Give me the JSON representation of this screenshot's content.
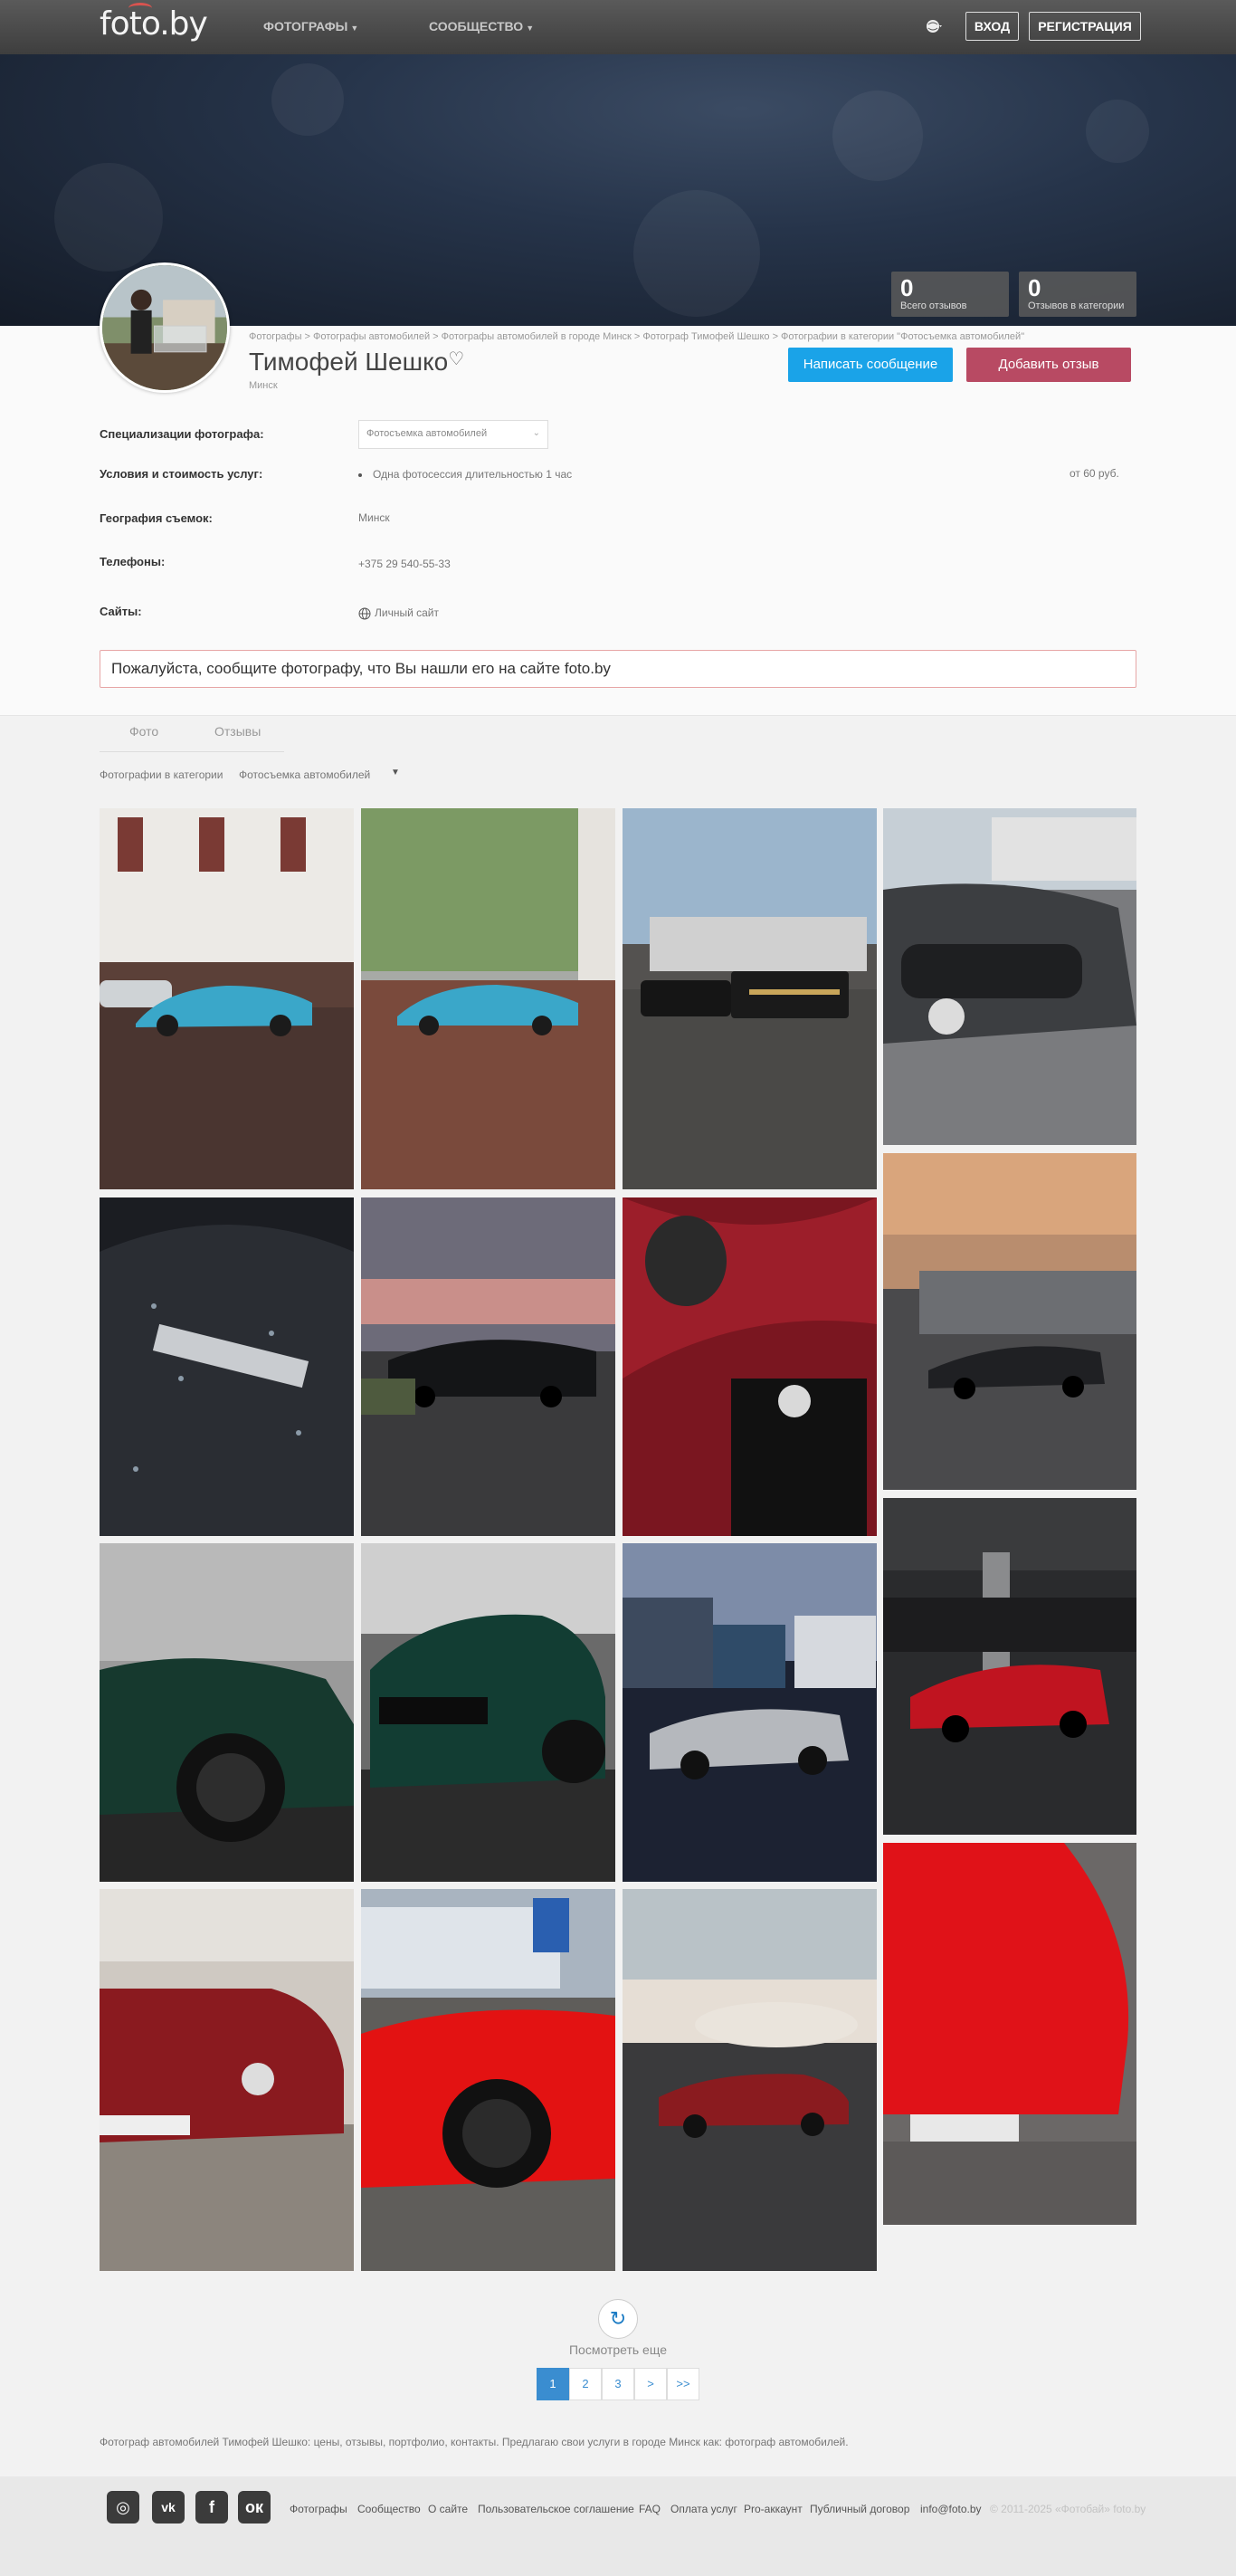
{
  "nav": {
    "logo": "foto.by",
    "photographers": "ФОТОГРАФЫ",
    "community": "СООБЩЕСТВО",
    "login": "ВХОД",
    "register": "РЕГИСТРАЦИЯ"
  },
  "stats": [
    {
      "num": "0",
      "label": "Всего отзывов"
    },
    {
      "num": "0",
      "label": "Отзывов в категории"
    }
  ],
  "breadcrumbs": "Фотографы > Фотографы автомобилей > Фотографы автомобилей в городе Минск > Фотограф Тимофей Шешко > Фотографии в категории \"Фотосъемка автомобилей\"",
  "profile": {
    "name": "Тимофей Шешко",
    "city": "Минск",
    "write_message": "Написать сообщение",
    "add_review": "Добавить отзыв"
  },
  "details": {
    "spec_label": "Специализации фотографа:",
    "spec_value": "Фотосъемка автомобилей",
    "terms_label": "Условия и стоимость услуг:",
    "terms_item": "Одна фотосессия длительностью 1 час",
    "terms_price": "от 60 руб.",
    "geo_label": "География съемок:",
    "geo_value": "Минск",
    "phones_label": "Телефоны:",
    "phones_value": "+375 29 540-55-33",
    "sites_label": "Сайты:",
    "sites_value": "Личный сайт"
  },
  "notice": "Пожалуйста, сообщите фотографу, что Вы нашли его на сайте foto.by",
  "tabs": {
    "photo": "Фото",
    "reviews": "Отзывы"
  },
  "category": {
    "label": "Фотографии в категории",
    "value": "Фотосъемка автомобилей"
  },
  "more": "Посмотреть еще",
  "pagination": [
    "1",
    "2",
    "3",
    ">",
    ">>"
  ],
  "seo_text": "Фотограф автомобилей Тимофей Шешко: цены, отзывы, портфолио, контакты. Предлагаю свои услуги в городе Минск как: фотограф автомобилей.",
  "footer": {
    "links": [
      "Фотографы",
      "Сообщество",
      "О сайте",
      "Пользовательское соглашение",
      "FAQ",
      "Оплата услуг",
      "Pro-аккаунт",
      "Публичный договор",
      "info@foto.by"
    ],
    "copyright": "© 2011-2025 «Фотобай» foto.by"
  },
  "photos": [
    {
      "name": "porsche-blue-1"
    },
    {
      "name": "porsche-blue-2"
    },
    {
      "name": "black-suvs"
    },
    {
      "name": "mercedes-amg-front"
    },
    {
      "name": "ferrari-wet"
    },
    {
      "name": "black-sports-car-dusk"
    },
    {
      "name": "red-alfa-romeo"
    },
    {
      "name": "mercedes-amg-sunset"
    },
    {
      "name": "green-bmw-side"
    },
    {
      "name": "green-bmw-front"
    },
    {
      "name": "porsche-boxster"
    },
    {
      "name": "red-alfa-parking"
    },
    {
      "name": "red-mustang-front"
    },
    {
      "name": "red-corvette-wheel"
    },
    {
      "name": "red-mustang-arena"
    },
    {
      "name": "red-corvette-plate"
    }
  ]
}
